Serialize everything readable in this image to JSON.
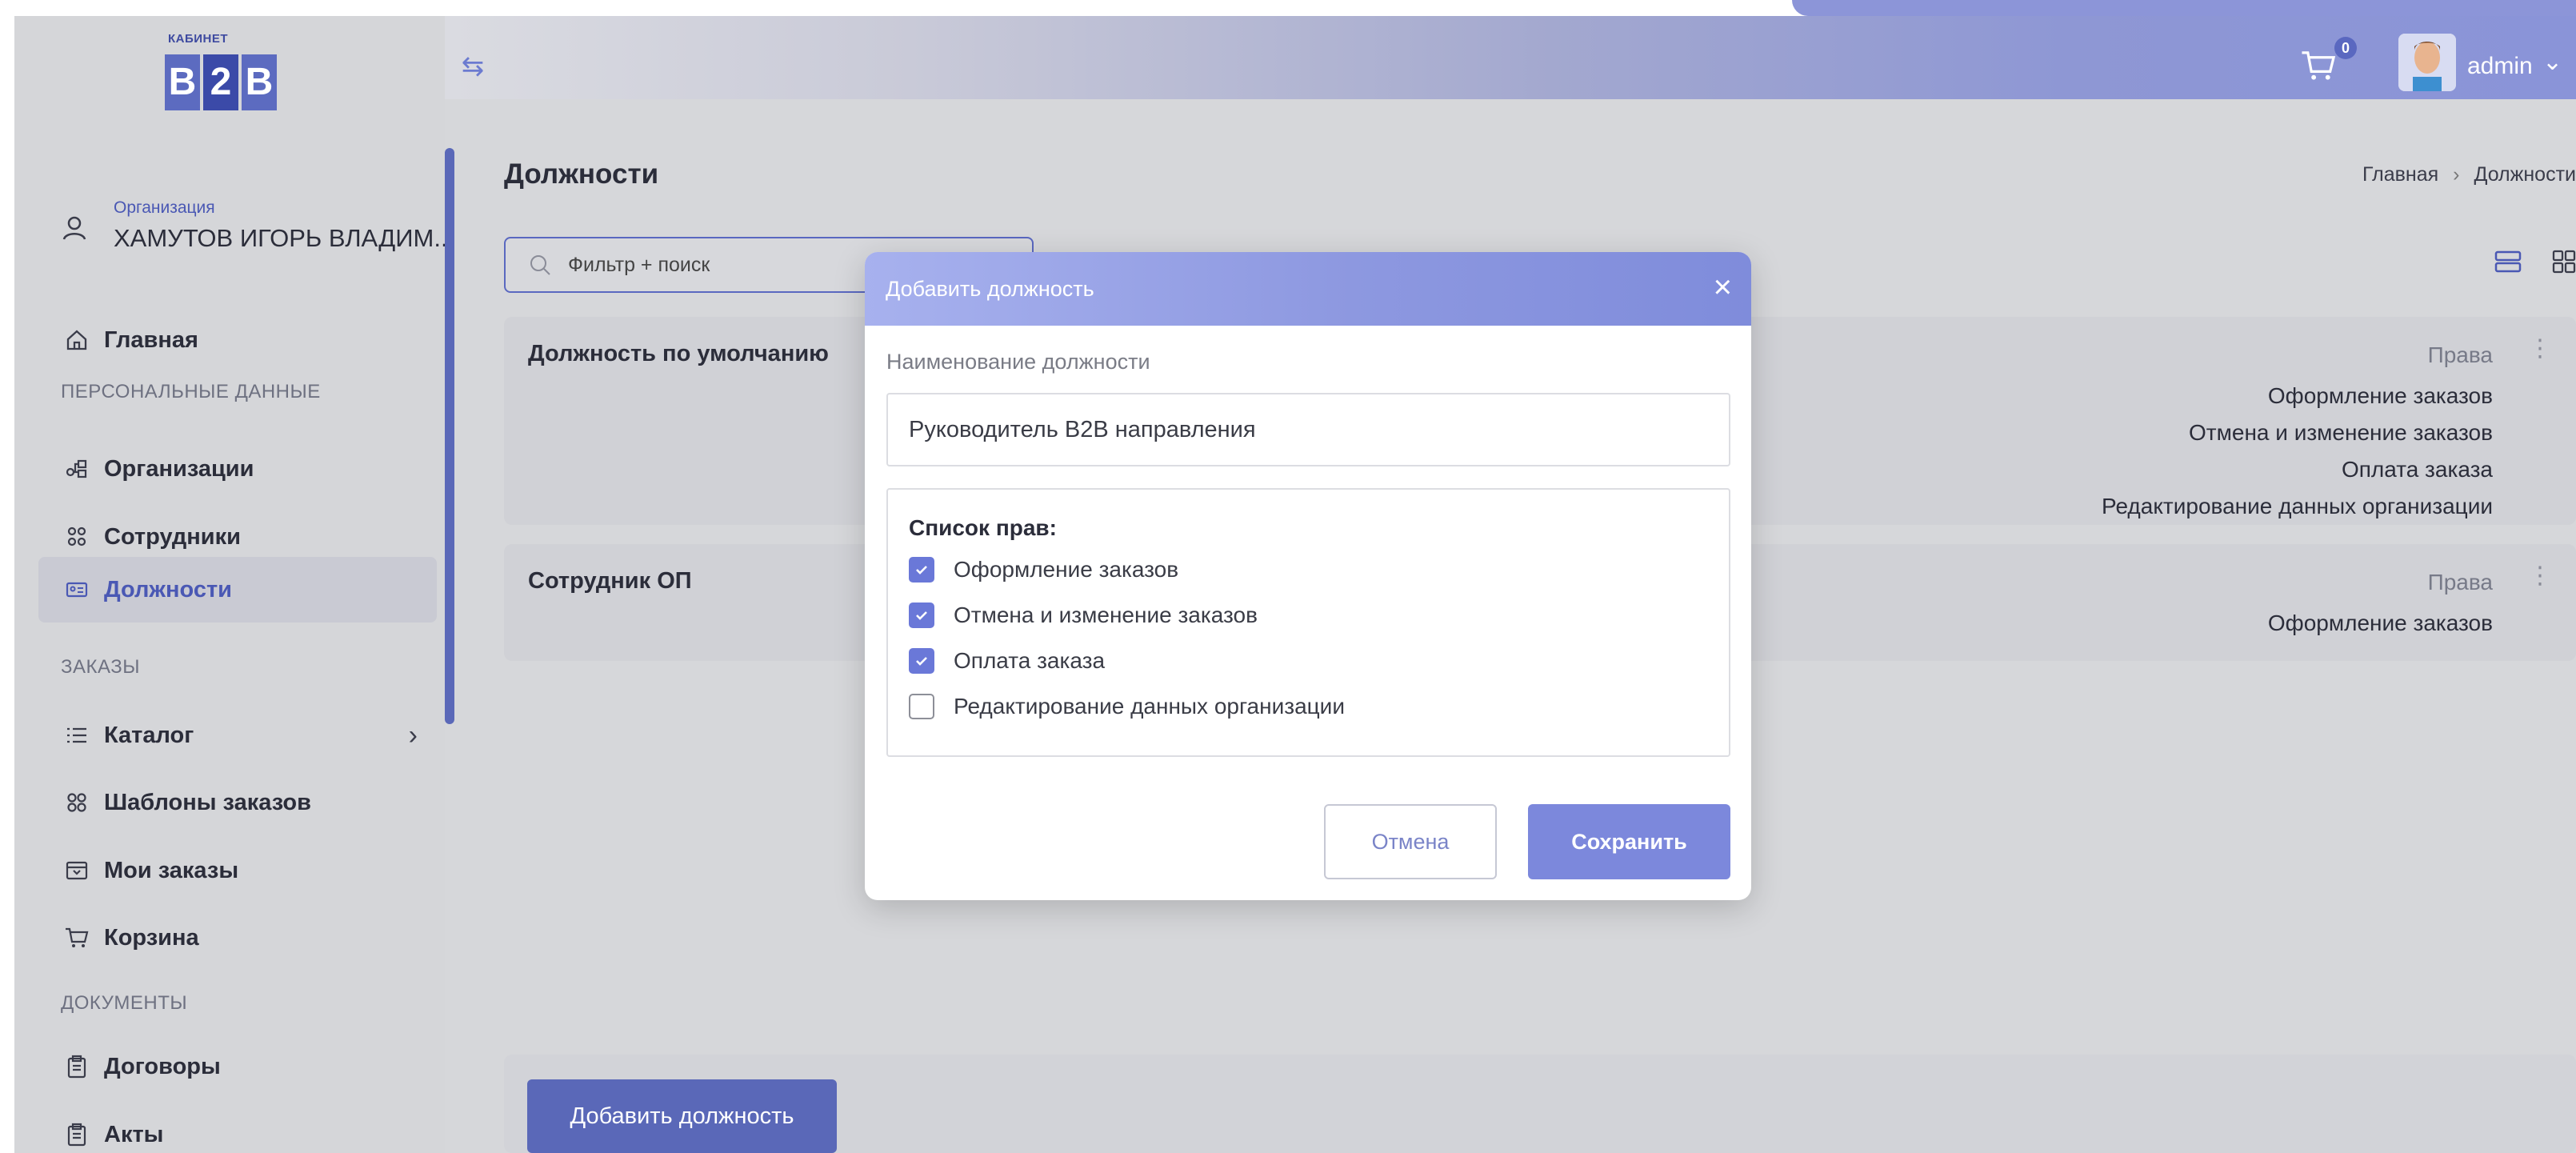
{
  "logo": {
    "top_text": "КАБИНЕТ",
    "b1": "B",
    "b2": "2",
    "b3": "B"
  },
  "header": {
    "cart_count": "0",
    "user_name": "admin"
  },
  "org": {
    "label": "Организация",
    "name": "ХАМУТОВ ИГОРЬ ВЛАДИМ..."
  },
  "sidebar": {
    "home": "Главная",
    "section_personal": "ПЕРСОНАЛЬНЫЕ ДАННЫЕ",
    "organizations": "Организации",
    "employees": "Сотрудники",
    "positions": "Должности",
    "section_orders": "ЗАКАЗЫ",
    "catalog": "Каталог",
    "order_templates": "Шаблоны заказов",
    "my_orders": "Мои заказы",
    "cart": "Корзина",
    "section_documents": "ДОКУМЕНТЫ",
    "contracts": "Договоры",
    "acts": "Акты"
  },
  "page": {
    "title": "Должности",
    "breadcrumb_home": "Главная",
    "breadcrumb_current": "Должности",
    "search_placeholder": "Фильтр + поиск",
    "add_button": "Добавить должность"
  },
  "cards": [
    {
      "title": "Должность по умолчанию",
      "rights_header": "Права",
      "rights": [
        "Оформление заказов",
        "Отмена и изменение заказов",
        "Оплата заказа",
        "Редактирование данных организации"
      ]
    },
    {
      "title": "Сотрудник ОП",
      "rights_header": "Права",
      "rights": [
        "Оформление заказов"
      ]
    }
  ],
  "modal": {
    "title": "Добавить должность",
    "field_label": "Наименование должности",
    "field_value": "Руководитель B2B направления",
    "rights_title": "Список прав:",
    "rights": [
      {
        "label": "Оформление заказов",
        "checked": true
      },
      {
        "label": "Отмена и изменение заказов",
        "checked": true
      },
      {
        "label": "Оплата заказа",
        "checked": true
      },
      {
        "label": "Редактирование данных организации",
        "checked": false
      }
    ],
    "cancel": "Отмена",
    "save": "Сохранить"
  },
  "colors": {
    "accent": "#5a68b8",
    "checkbox": "#6a78d8",
    "modal_header": "#8d98e0"
  }
}
